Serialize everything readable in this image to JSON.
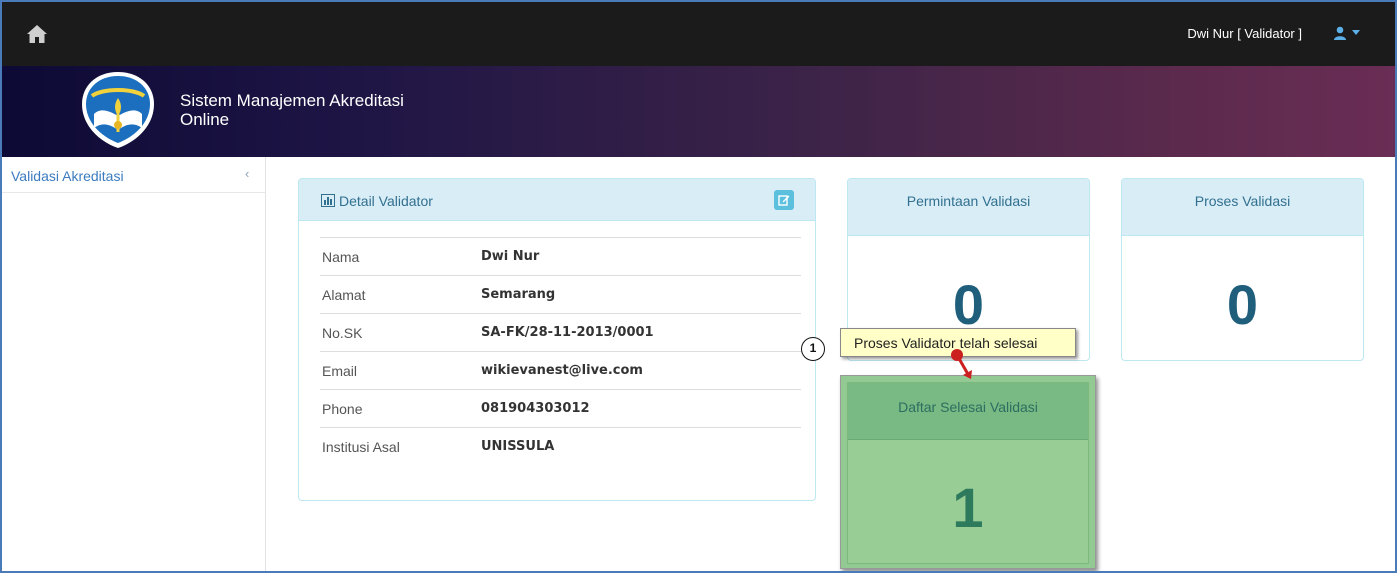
{
  "navbar": {
    "home_icon": "home-icon",
    "user_label": "Dwi Nur [ Validator ]",
    "user_menu_icon": "user-icon"
  },
  "banner": {
    "title_line1": "Sistem Manajemen Akreditasi",
    "title_line2": "Online"
  },
  "sidebar": {
    "items": [
      {
        "label": "Validasi Akreditasi",
        "chevron": "‹"
      }
    ]
  },
  "detail_panel": {
    "title": "Detail Validator",
    "rows": [
      {
        "label": "Nama",
        "value": "Dwi Nur"
      },
      {
        "label": "Alamat",
        "value": "Semarang"
      },
      {
        "label": "No.SK",
        "value": "SA-FK/28-11-2013/0001"
      },
      {
        "label": "Email",
        "value": "wikievanest@live.com"
      },
      {
        "label": "Phone",
        "value": "081904303012"
      },
      {
        "label": "Institusi Asal",
        "value": "UNISSULA"
      }
    ]
  },
  "stats": {
    "permintaan": {
      "label": "Permintaan Validasi",
      "count": "0"
    },
    "proses": {
      "label": "Proses Validasi",
      "count": "0"
    },
    "selesai": {
      "label": "Daftar Selesai Validasi",
      "count": "1"
    }
  },
  "annotation": {
    "step": "1",
    "text": "Proses Validator telah selesai"
  },
  "colors": {
    "navbar_bg": "#1b1b1b",
    "panel_head": "#d9edf7",
    "panel_border": "#bce8f1",
    "stat_number": "#1f5f7c",
    "green_box": "#93c993",
    "callout_bg": "#ffffc7",
    "pointer": "#cc1f1f"
  }
}
